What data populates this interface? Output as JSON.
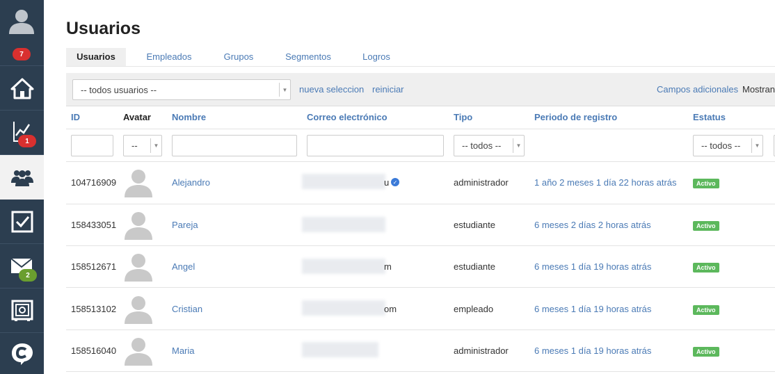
{
  "sidebar": {
    "profile_badge": "7",
    "reports_badge": "1",
    "messages_badge": "2"
  },
  "page": {
    "title": "Usuarios"
  },
  "tabs": [
    {
      "label": "Usuarios",
      "active": true
    },
    {
      "label": "Empleados"
    },
    {
      "label": "Grupos"
    },
    {
      "label": "Segmentos"
    },
    {
      "label": "Logros"
    }
  ],
  "filterbar": {
    "selection_value": "-- todos usuarios --",
    "new_selection": "nueva seleccion",
    "reset": "reiniciar",
    "extra_fields": "Campos adicionales",
    "showing": "Mostrand"
  },
  "columns": {
    "id": "ID",
    "avatar": "Avatar",
    "name": "Nombre",
    "email": "Correo electrónico",
    "type": "Tipo",
    "period": "Periodo de registro",
    "status": "Estatus"
  },
  "filters": {
    "avatar": "--",
    "type": "-- todos --",
    "status": "-- todos --"
  },
  "rows": [
    {
      "id": "104716909",
      "name": "Alejandro",
      "email_tail": "u",
      "type": "administrador",
      "period": "1 año 2 meses 1 día 22 horas atrás",
      "status": "Activo"
    },
    {
      "id": "158433051",
      "name": "Pareja",
      "email_tail": "",
      "type": "estudiante",
      "period": "6 meses 2 días 2 horas atrás",
      "status": "Activo"
    },
    {
      "id": "158512671",
      "name": "Angel",
      "email_tail": "m",
      "type": "estudiante",
      "period": "6 meses 1 día 19 horas atrás",
      "status": "Activo"
    },
    {
      "id": "158513102",
      "name": "Cristian",
      "email_tail": "om",
      "type": "empleado",
      "period": "6 meses 1 día 19 horas atrás",
      "status": "Activo"
    },
    {
      "id": "158516040",
      "name": "Maria",
      "email_tail": "",
      "type": "administrador",
      "period": "6 meses 1 día 19 horas atrás",
      "status": "Activo"
    }
  ],
  "colors": {
    "sidebar": "#2c3e50",
    "link": "#4a7ab5",
    "active_badge": "#5cb85c",
    "alert_badge": "#d9302f",
    "message_badge": "#6a9e2f"
  }
}
